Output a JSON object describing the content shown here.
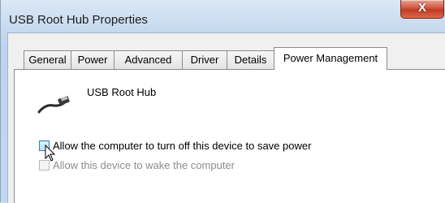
{
  "window": {
    "title": "USB Root Hub Properties",
    "close_glyph": "X"
  },
  "tabs": [
    {
      "label": "General",
      "active": false
    },
    {
      "label": "Power",
      "active": false
    },
    {
      "label": "Advanced",
      "active": false
    },
    {
      "label": "Driver",
      "active": false
    },
    {
      "label": "Details",
      "active": false
    },
    {
      "label": "Power Management",
      "active": true
    }
  ],
  "device": {
    "name": "USB Root Hub",
    "icon": "usb-cable-icon"
  },
  "options": [
    {
      "label": "Allow the computer to turn off this device to save power",
      "checked": false,
      "enabled": true
    },
    {
      "label": "Allow this device to wake the computer",
      "checked": false,
      "enabled": false
    }
  ],
  "colors": {
    "close_button": "#c23a22",
    "tab_border": "#898c95",
    "disabled_text": "#8c8c8c"
  }
}
